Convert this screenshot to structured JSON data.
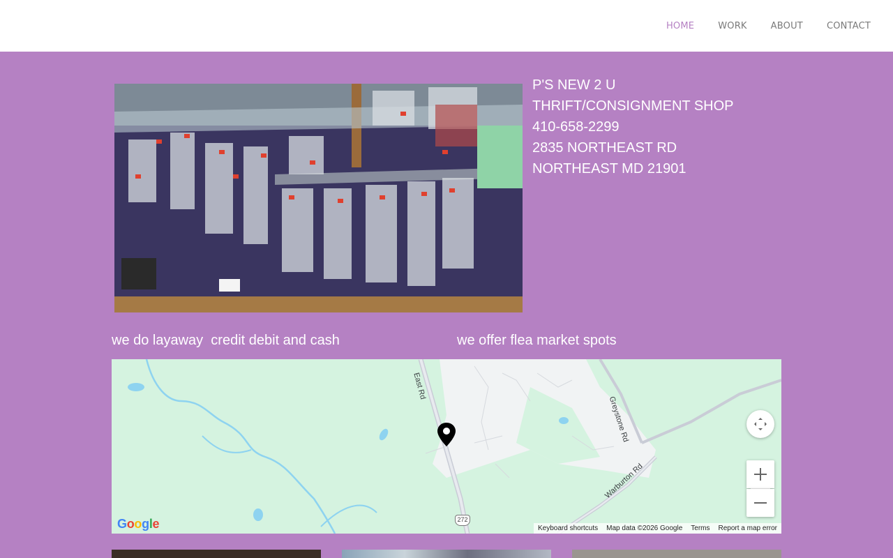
{
  "nav": {
    "items": [
      {
        "label": "HOME",
        "active": true
      },
      {
        "label": "WORK",
        "active": false
      },
      {
        "label": "ABOUT",
        "active": false
      },
      {
        "label": "CONTACT",
        "active": false
      }
    ]
  },
  "shop": {
    "lines": [
      "P'S NEW 2 U",
      "THRIFT/CONSIGNMENT SHOP",
      "410-658-2299",
      "2835 NORTHEAST RD",
      "NORTHEAST MD 21901"
    ]
  },
  "captions": {
    "left": "we do layaway  credit debit and cash",
    "right": "we offer flea market spots"
  },
  "map": {
    "roads": [
      "East Rd",
      "Greystone Rd",
      "Warburton Rd"
    ],
    "route_shield": "272",
    "attribution": {
      "keyboard": "Keyboard shortcuts",
      "data": "Map data ©2026 Google",
      "terms": "Terms",
      "report": "Report a map error"
    },
    "logo_letters": [
      "G",
      "o",
      "o",
      "g",
      "l",
      "e"
    ],
    "controls": [
      "fullscreen-icon",
      "zoom-in-icon",
      "zoom-out-icon"
    ]
  },
  "colors": {
    "background": "#b581c3",
    "nav_active": "#b581c3",
    "nav_text": "#7a7a7a",
    "map_land": "#d5f3e0",
    "map_water": "#8ed3f0"
  }
}
